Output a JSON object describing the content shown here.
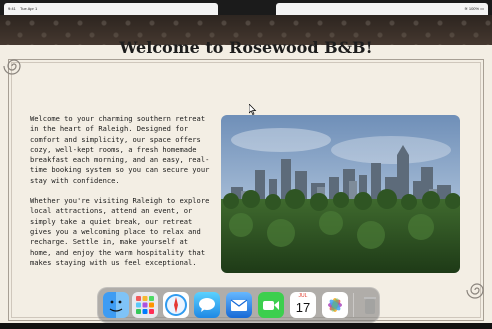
{
  "statusbar": {
    "time": "9:41",
    "date": "Tue Apr 1",
    "battery": "100%"
  },
  "page": {
    "title": "Welcome to Rosewood B&B!",
    "intro_paragraphs": [
      "Welcome to your charming southern retreat in the heart of Raleigh. Designed for comfort and simplicity, our space offers cozy, well-kept rooms, a fresh homemade breakfast each morning, and an easy, real-time booking system so you can secure your stay with confidence.",
      "Whether you're visiting Raleigh to explore local attractions, attend an event, or simply take a quiet break, our retreat gives you a welcoming place to relax and recharge. Settle in, make yourself at home, and enjoy the warm hospitality that makes staying with us feel exceptional."
    ]
  },
  "dock": {
    "items": [
      {
        "name": "finder-icon"
      },
      {
        "name": "launchpad-icon"
      },
      {
        "name": "safari-icon"
      },
      {
        "name": "messages-icon"
      },
      {
        "name": "mail-icon"
      },
      {
        "name": "facetime-icon"
      },
      {
        "name": "calendar-icon",
        "month": "JUL",
        "day": "17"
      },
      {
        "name": "photos-icon"
      },
      {
        "name": "trash-icon"
      }
    ]
  },
  "colors": {
    "page_bg": "#f3eee4",
    "frame": "#a79f94",
    "text": "#1b1b1b"
  }
}
